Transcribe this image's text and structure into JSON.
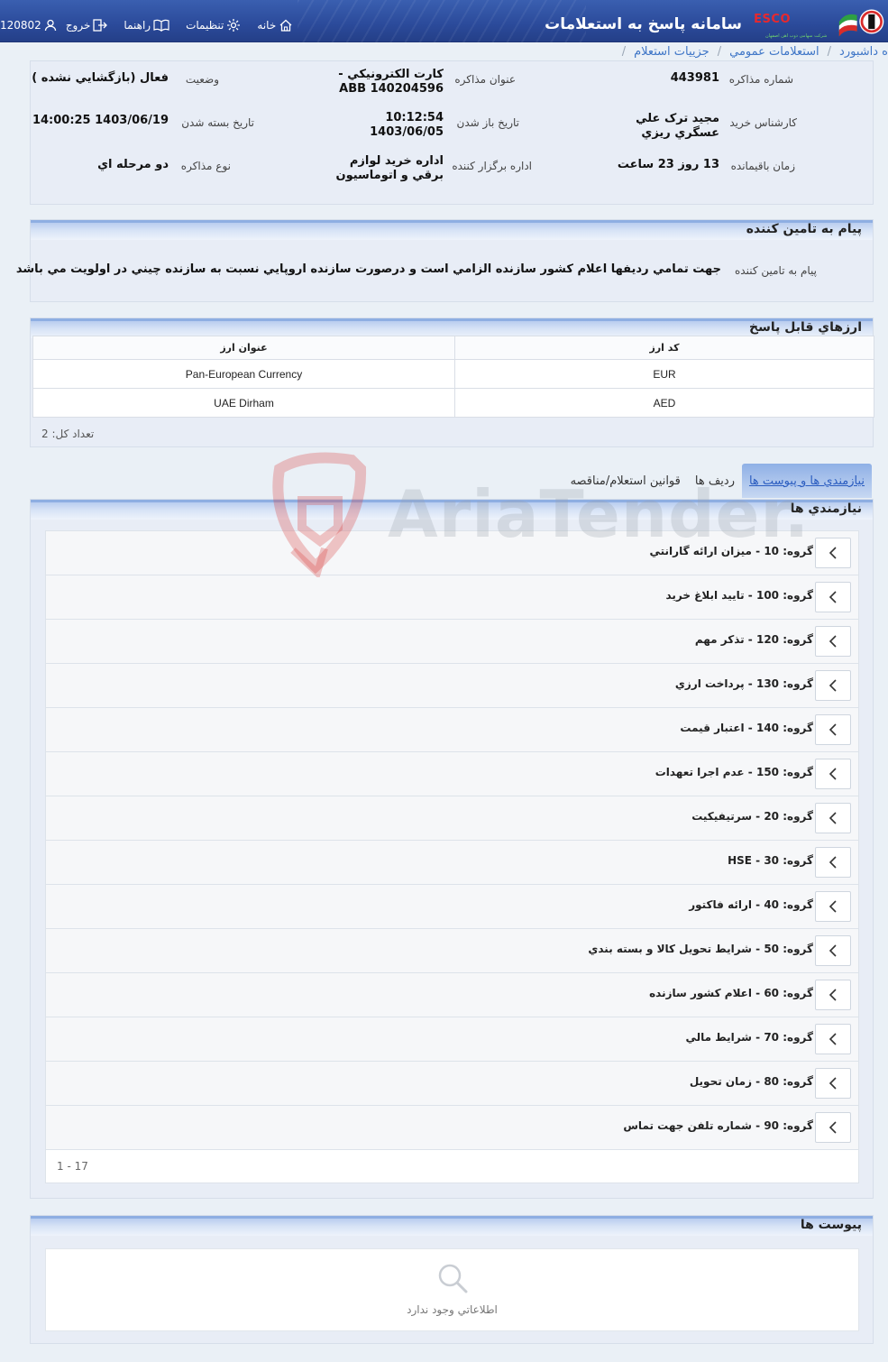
{
  "header": {
    "app_title": "سامانه پاسخ به استعلامات",
    "brand": "ESCO",
    "brand_sub": "شرکت سهامی ذوب آهن اصفهان",
    "menu": {
      "home": "خانه",
      "settings": "تنظیمات",
      "help": "راهنما",
      "logout": "خروج",
      "user_id": "120802"
    }
  },
  "breadcrumb": {
    "item1": "ه داشبورد",
    "item2": "استعلامات عمومي",
    "item3": "جزييات استعلام"
  },
  "details": {
    "inquiry_number_label": "شماره مذاکره",
    "inquiry_number": "443981",
    "title_label": "عنوان مذاکره",
    "title": "کارت الکترونيکي -ABB 140204596",
    "status_label": "وضعيت",
    "status": "فعال (بازگشايي نشده )",
    "buyer_label": "کارشناس خريد",
    "buyer": "مجيد ترک علي عسگري ريزي",
    "open_date_label": "تاريخ باز شدن",
    "open_date": "10:12:54 1403/06/05",
    "close_date_label": "تاريخ بسته شدن",
    "close_date": "1403/06/19 14:00:25",
    "remaining_label": "زمان باقيمانده",
    "remaining": "13 روز 23 ساعت",
    "organizer_label": "اداره برگزار کننده",
    "organizer": "اداره خريد لوازم برقي و اتوماسيون",
    "type_label": "نوع مذاکره",
    "type": "دو مرحله اي"
  },
  "message": {
    "section_title": "پيام به تامين کننده",
    "label": "پيام به تامين کننده",
    "text": "جهت تمامي رديفها اعلام کشور سازنده الزامي است و درصورت سازنده اروپايي نسبت به سازنده چيني در اولويت مي باشد"
  },
  "currencies": {
    "section_title": "ارزهاي قابل پاسخ",
    "col_code": "کد ارز",
    "col_name": "عنوان ارز",
    "rows": [
      {
        "code": "EUR",
        "name": "Pan-European Currency"
      },
      {
        "code": "AED",
        "name": "UAE Dirham"
      }
    ],
    "count_text": "تعداد کل: 2"
  },
  "tabs": {
    "requirements": "نيازمندي ها و پيوست ها",
    "rows": "رديف ها",
    "rules": "قوانين استعلام/مناقصه"
  },
  "requirements": {
    "section_title": "نيازمندي ها",
    "groups": [
      "گروه: 10 - ميزان ارائه گارانتي",
      "گروه: 100 - تاييد ابلاغ خريد",
      "گروه: 120 - تذکر مهم",
      "گروه: 130 - پرداخت ارزي",
      "گروه: 140 - اعتبار قيمت",
      "گروه: 150 - عدم اجرا تعهدات",
      "گروه: 20 - سرتيفيکيت",
      "گروه: 30 - HSE",
      "گروه: 40 - ارائه فاکتور",
      "گروه: 50 - شرايط تحويل کالا و بسته بندي",
      "گروه: 60 - اعلام کشور سازنده",
      "گروه: 70 - شرايط مالي",
      "گروه: 80 - زمان تحويل",
      "گروه: 90 - شماره تلفن جهت تماس"
    ],
    "pager": "1 - 17"
  },
  "attachments": {
    "section_title": "پيوست ها",
    "empty_text": "اطلاعاتي وجود ندارد"
  },
  "watermark_text": "AriaTender.neT",
  "colors": {
    "header_blue": "#2b4a9a",
    "link_blue": "#3f76c7",
    "panel_bg": "#e8edf6",
    "watermark_red": "#d93a3a"
  }
}
